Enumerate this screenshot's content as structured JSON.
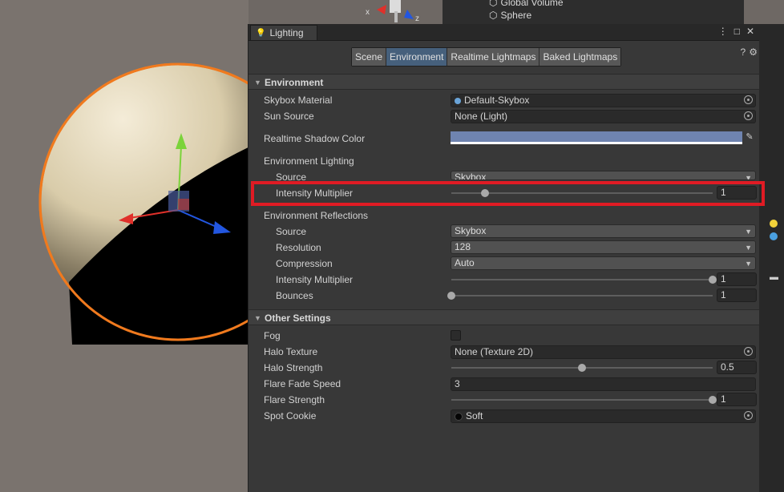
{
  "hierarchy": {
    "items": [
      "Global Volume",
      "Sphere"
    ]
  },
  "scene": {
    "axis_labels": [
      "x",
      "z"
    ]
  },
  "window": {
    "tab_title": "Lighting"
  },
  "tabs": {
    "items": [
      "Scene",
      "Environment",
      "Realtime Lightmaps",
      "Baked Lightmaps"
    ],
    "active": "Environment"
  },
  "environment": {
    "header": "Environment",
    "skybox_material_label": "Skybox Material",
    "skybox_material_value": "Default-Skybox",
    "sun_source_label": "Sun Source",
    "sun_source_value": "None (Light)",
    "shadow_color_label": "Realtime Shadow Color",
    "shadow_color": "#6f84b0",
    "env_lighting_label": "Environment Lighting",
    "lighting_source_label": "Source",
    "lighting_source_value": "Skybox",
    "intensity_label": "Intensity Multiplier",
    "intensity_value": "1",
    "intensity_fraction": 0.13,
    "env_reflections_label": "Environment Reflections",
    "refl_source_label": "Source",
    "refl_source_value": "Skybox",
    "resolution_label": "Resolution",
    "resolution_value": "128",
    "compression_label": "Compression",
    "compression_value": "Auto",
    "refl_intensity_label": "Intensity Multiplier",
    "refl_intensity_value": "1",
    "refl_intensity_fraction": 1.0,
    "bounces_label": "Bounces",
    "bounces_value": "1",
    "bounces_fraction": 0.0
  },
  "other": {
    "header": "Other Settings",
    "fog_label": "Fog",
    "fog_checked": false,
    "halo_texture_label": "Halo Texture",
    "halo_texture_value": "None (Texture 2D)",
    "halo_strength_label": "Halo Strength",
    "halo_strength_value": "0.5",
    "halo_strength_fraction": 0.5,
    "flare_fade_label": "Flare Fade Speed",
    "flare_fade_value": "3",
    "flare_strength_label": "Flare Strength",
    "flare_strength_value": "1",
    "flare_strength_fraction": 1.0,
    "spot_cookie_label": "Spot Cookie",
    "spot_cookie_value": "Soft"
  },
  "colors": {
    "highlight": "#e01b24",
    "active_tab": "#46607c",
    "sphere_outline": "#f07a1e"
  }
}
